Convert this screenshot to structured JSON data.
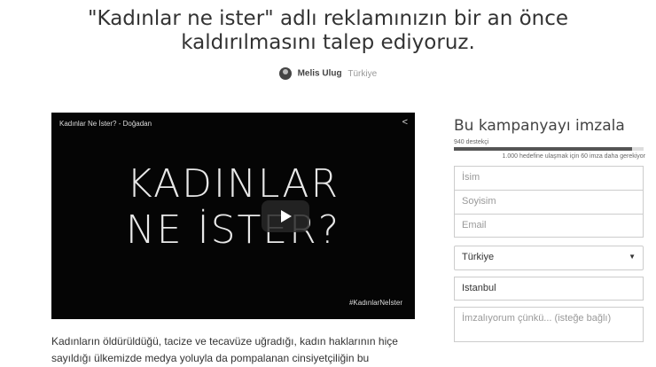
{
  "petition": {
    "title": "\"Kadınlar ne ister\" adlı reklamınızın bir an önce kaldırılmasını talep ediyoruz.",
    "author": "Melis Ulug",
    "country": "Türkiye"
  },
  "video": {
    "title": "Kadınlar Ne İster? - Doğadan",
    "big_text_line1": "KADINLAR",
    "big_text_line2": "NE İSTER?",
    "hashtag": "#KadınlarNeİster",
    "share_icon": "share-icon",
    "play_icon": "play-icon"
  },
  "description": "Kadınların öldürüldüğü, tacize ve tecavüze uğradığı, kadın haklarının hiçe sayıldığı ülkemizde medya yoluyla da pompalanan cinsiyetçiliğin bu",
  "sign": {
    "heading": "Bu kampanyayı imzala",
    "supporters": "940 destekçi",
    "progress": 0.94,
    "goal_text": "1.000 hedefine ulaşmak için 60 imza daha gerekiyor",
    "first_name_placeholder": "İsim",
    "last_name_placeholder": "Soyisim",
    "email_placeholder": "Email",
    "country_value": "Türkiye",
    "city_value": "Istanbul",
    "reason_placeholder": "İmzalıyorum çünkü... (isteğe bağlı)"
  },
  "colors": {
    "accent": "#555555",
    "video_bg": "#050505"
  }
}
